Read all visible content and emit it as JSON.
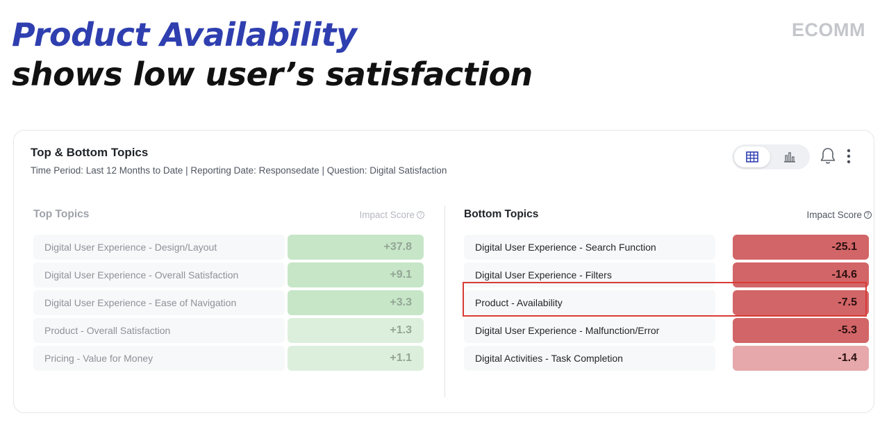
{
  "headline": {
    "line1": "Product Availability",
    "line2": "shows low user’s satisfaction"
  },
  "brand": "ECOMM",
  "card": {
    "title": "Top & Bottom Topics",
    "subtitle": "Time Period: Last 12 Months to Date | Reporting Date: Responsedate | Question: Digital Satisfaction",
    "toolbar": {
      "table_view_icon": "table-grid-icon",
      "chart_view_icon": "bar-chart-icon",
      "active_view": "table",
      "notifications_icon": "bell-icon",
      "more_icon": "kebab-menu-icon"
    },
    "top": {
      "title": "Top Topics",
      "score_header": "Impact Score",
      "rows": [
        {
          "label": "Digital User Experience - Design/Layout",
          "score": "+37.8",
          "color": "#c6e6c7"
        },
        {
          "label": "Digital User Experience - Overall Satisfaction",
          "score": "+9.1",
          "color": "#c6e6c7"
        },
        {
          "label": "Digital User Experience - Ease of Navigation",
          "score": "+3.3",
          "color": "#c6e6c7"
        },
        {
          "label": "Product - Overall Satisfaction",
          "score": "+1.3",
          "color": "#dcefdc"
        },
        {
          "label": "Pricing - Value for Money",
          "score": "+1.1",
          "color": "#dcefdc"
        }
      ]
    },
    "bottom": {
      "title": "Bottom Topics",
      "score_header": "Impact Score",
      "rows": [
        {
          "label": "Digital User Experience - Search Function",
          "score": "-25.1",
          "color": "#d26567"
        },
        {
          "label": "Digital User Experience - Filters",
          "score": "-14.6",
          "color": "#d26567"
        },
        {
          "label": "Product - Availability",
          "score": "-7.5",
          "color": "#d26567",
          "highlighted": true
        },
        {
          "label": "Digital User Experience - Malfunction/Error",
          "score": "-5.3",
          "color": "#d26567"
        },
        {
          "label": "Digital Activities - Task Completion",
          "score": "-1.4",
          "color": "#e6a8aa"
        }
      ]
    },
    "highlight_color": "#d93b35"
  }
}
